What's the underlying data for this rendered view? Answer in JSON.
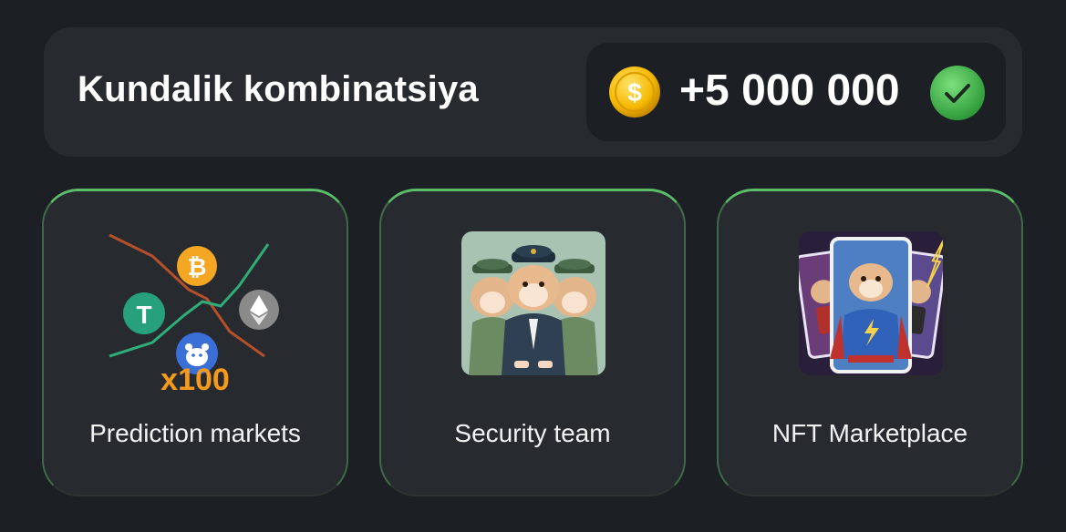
{
  "daily_combo": {
    "title": "Kundalik kombinatsiya",
    "reward_amount": "+5 000 000",
    "coin_icon": "dollar-coin-icon",
    "status_icon": "check-circle-icon"
  },
  "cards": [
    {
      "label": "Prediction markets",
      "badge": "x100",
      "icon": "prediction-chart-icon"
    },
    {
      "label": "Security team",
      "icon": "hamster-security-image"
    },
    {
      "label": "NFT Marketplace",
      "icon": "hamster-nft-cards-image"
    }
  ],
  "colors": {
    "background": "#1c1f24",
    "panel": "#272a2f",
    "accent_green": "#5bbf6a",
    "coin_gold": "#f5c400",
    "badge_orange": "#f59a1c"
  }
}
